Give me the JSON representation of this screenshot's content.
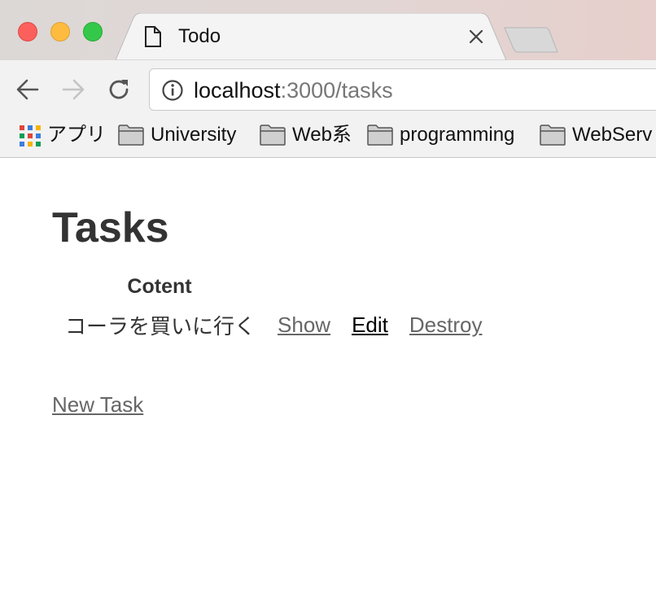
{
  "window": {
    "traffic_lights": [
      "close",
      "minimize",
      "maximize"
    ]
  },
  "tab": {
    "title": "Todo",
    "favicon": "document-icon",
    "close_icon": "close-icon"
  },
  "toolbar": {
    "url_host": "localhost",
    "url_path": ":3000/tasks",
    "info_icon": "info-icon"
  },
  "bookmarks": [
    {
      "label": "アプリ",
      "icon": "apps-grid-icon"
    },
    {
      "label": "University",
      "icon": "folder-icon"
    },
    {
      "label": "Web系",
      "icon": "folder-icon"
    },
    {
      "label": "programming",
      "icon": "folder-icon"
    },
    {
      "label": "WebServ",
      "icon": "folder-icon"
    }
  ],
  "page": {
    "title": "Tasks",
    "table": {
      "header_content": "Cotent",
      "rows": [
        {
          "content": "コーラを買いに行く",
          "show_label": "Show",
          "edit_label": "Edit",
          "destroy_label": "Destroy"
        }
      ]
    },
    "new_task_label": "New Task"
  },
  "colors": {
    "traffic_close": "#fc605c",
    "traffic_minimize": "#fdbc40",
    "traffic_maximize": "#34c84a",
    "link": "#666666",
    "link_visited": "#000000",
    "heading": "#333333"
  }
}
